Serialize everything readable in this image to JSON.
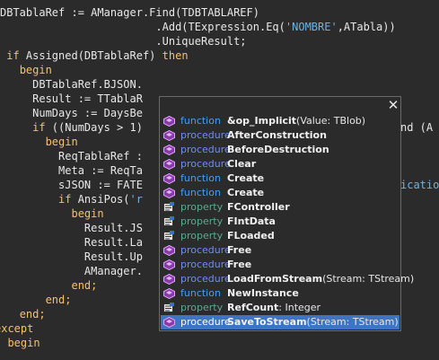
{
  "code_lines": [
    {
      "segs": [
        {
          "t": "DBTablaRef := AManager.Find(TDBTABLAREF)"
        }
      ]
    },
    {
      "segs": [
        {
          "t": "                        .Add(TExpression.Eq("
        },
        {
          "t": "'NOMBRE'",
          "c": "str"
        },
        {
          "t": ",ATabla))"
        }
      ]
    },
    {
      "segs": [
        {
          "t": "                        .UniqueResult;"
        }
      ]
    },
    {
      "segs": [
        {
          "t": " "
        },
        {
          "t": "if",
          "c": "kw"
        },
        {
          "t": " Assigned(DBTablaRef) "
        },
        {
          "t": "then",
          "c": "kw"
        }
      ]
    },
    {
      "segs": [
        {
          "t": "   "
        },
        {
          "t": "begin",
          "c": "kw"
        }
      ]
    },
    {
      "segs": [
        {
          "t": "     DBTablaRef.BJSON."
        }
      ]
    },
    {
      "segs": [
        {
          "t": "     Result := TTablaR"
        }
      ]
    },
    {
      "segs": [
        {
          "t": "     NumDays := DaysBe"
        }
      ]
    },
    {
      "segs": [
        {
          "t": "     "
        },
        {
          "t": "if",
          "c": "kw"
        },
        {
          "t": " ((NumDays > 1)"
        }
      ]
    },
    {
      "segs": [
        {
          "t": "       "
        },
        {
          "t": "begin",
          "c": "kw"
        }
      ]
    },
    {
      "segs": [
        {
          "t": "         ReqTablaRef :"
        }
      ]
    },
    {
      "segs": [
        {
          "t": "         Meta := ReqTa"
        }
      ]
    },
    {
      "segs": [
        {
          "t": "         sJSON := FATE"
        }
      ]
    },
    {
      "segs": [
        {
          "t": "         "
        },
        {
          "t": "if",
          "c": "kw"
        },
        {
          "t": " AnsiPos("
        },
        {
          "t": "'r",
          "c": "str"
        }
      ]
    },
    {
      "segs": [
        {
          "t": "           "
        },
        {
          "t": "begin",
          "c": "kw"
        }
      ]
    },
    {
      "segs": [
        {
          "t": "             Result.JS"
        }
      ]
    },
    {
      "segs": [
        {
          "t": "             Result.La"
        }
      ]
    },
    {
      "segs": [
        {
          "t": "             Result.Up"
        }
      ]
    },
    {
      "segs": [
        {
          "t": "             AManager."
        }
      ]
    },
    {
      "segs": [
        {
          "t": "           "
        },
        {
          "t": "end;",
          "c": "kw"
        }
      ]
    },
    {
      "segs": [
        {
          "t": "       "
        },
        {
          "t": "end;",
          "c": "kw"
        }
      ]
    },
    {
      "segs": [
        {
          "t": "   "
        },
        {
          "t": "end;",
          "c": "kw"
        }
      ]
    },
    {
      "segs": [
        {
          "t": "except",
          "c": "kw"
        }
      ]
    },
    {
      "segs": [
        {
          "t": "  "
        },
        {
          "t": "begin",
          "c": "kw"
        }
      ]
    }
  ],
  "right_fragments": {
    "line8": "nd (A",
    "line12": "ication"
  },
  "popup": {
    "close_label": "✕",
    "items": [
      {
        "kind": "function",
        "name": "&op_Implicit",
        "params": "(Value: TBlob)",
        "icon": "method-icon"
      },
      {
        "kind": "procedure",
        "name": "AfterConstruction",
        "params": "",
        "icon": "method-icon"
      },
      {
        "kind": "procedure",
        "name": "BeforeDestruction",
        "params": "",
        "icon": "method-icon"
      },
      {
        "kind": "procedure",
        "name": "Clear",
        "params": "",
        "icon": "method-icon"
      },
      {
        "kind": "function",
        "name": "Create",
        "params": "",
        "icon": "method-icon"
      },
      {
        "kind": "function",
        "name": "Create",
        "params": "",
        "icon": "method-icon"
      },
      {
        "kind": "property",
        "name": "FController",
        "params": "",
        "icon": "property-icon"
      },
      {
        "kind": "property",
        "name": "FIntData",
        "params": "",
        "icon": "property-icon"
      },
      {
        "kind": "property",
        "name": "FLoaded",
        "params": "",
        "icon": "property-icon"
      },
      {
        "kind": "procedure",
        "name": "Free",
        "params": "",
        "icon": "method-icon"
      },
      {
        "kind": "procedure",
        "name": "Free",
        "params": "",
        "icon": "method-icon"
      },
      {
        "kind": "procedure",
        "name": "LoadFromStream",
        "params": "(Stream: TStream)",
        "icon": "method-icon"
      },
      {
        "kind": "function",
        "name": "NewInstance",
        "params": "",
        "icon": "method-icon"
      },
      {
        "kind": "property",
        "name": "RefCount",
        "params": ": Integer",
        "icon": "property-icon"
      },
      {
        "kind": "procedure",
        "name": "SaveToStream",
        "params": "(Stream: TStream)",
        "icon": "method-icon",
        "selected": true
      }
    ]
  },
  "colors": {
    "background": "#2b2b2b",
    "keyword": "#f5c26b",
    "string": "#6bb4e6",
    "selection": "#3e74c4"
  }
}
